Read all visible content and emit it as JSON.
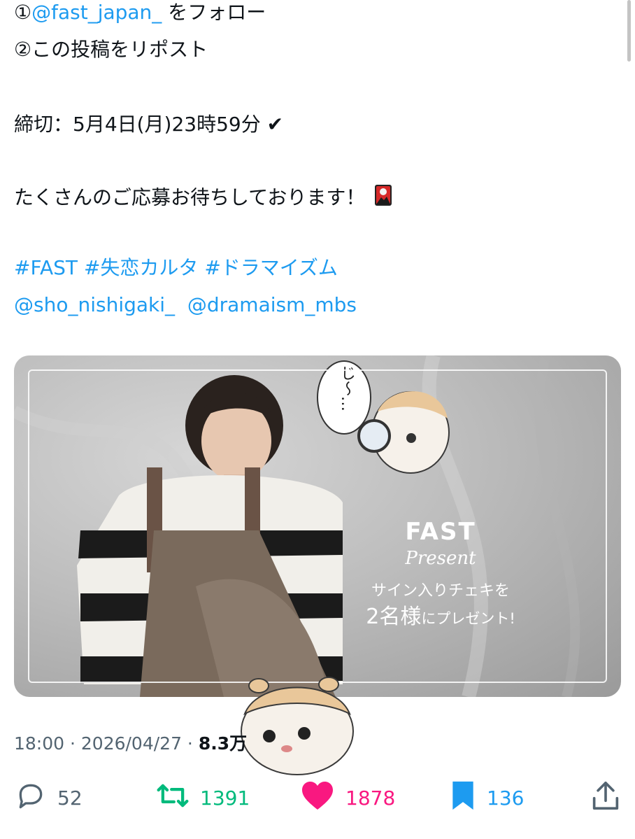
{
  "post": {
    "line1_mention": "@fast_japan_",
    "line1_prefix": "①",
    "line1_suffix": " をフォロー",
    "line2": "②この投稿をリポスト",
    "deadline": "締切：5月4日(月)23時59分 ✔",
    "closing": "たくさんのご応募お待ちしております！",
    "hashtags": [
      "#FAST",
      "#失恋カルタ",
      "#ドラマイズム"
    ],
    "mentions": [
      "@sho_nishigaki_",
      "@dramaism_mbs"
    ]
  },
  "image": {
    "bubble_text": "じ〜…",
    "brand": "FAST",
    "present": "Present",
    "caption1": "サイン入りチェキを",
    "caption2_big": "2名様",
    "caption2_rest": "にプレゼント!"
  },
  "meta": {
    "time": "18:00",
    "date": "2026/04/27",
    "views": "8.3万"
  },
  "actions": {
    "replies": "52",
    "reposts": "1391",
    "likes": "1878",
    "bookmarks": "136"
  },
  "colors": {
    "link": "#1d9bf0",
    "repost": "#00ba7c",
    "like": "#f91880",
    "bookmark": "#1d9bf0",
    "muted": "#536471"
  }
}
